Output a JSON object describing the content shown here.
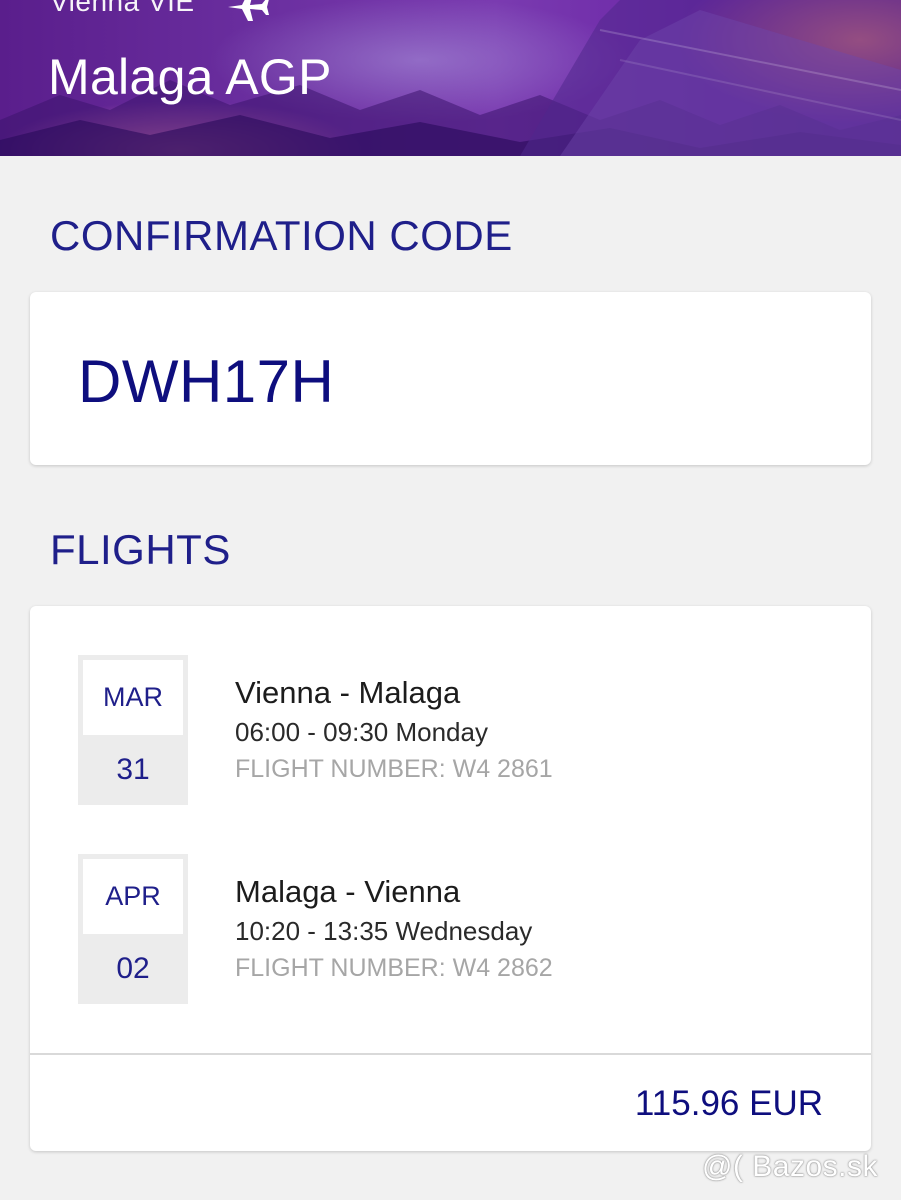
{
  "header": {
    "from": "Vienna VIE",
    "to": "Malaga AGP",
    "plane_icon": "plane-icon"
  },
  "confirmation": {
    "title": "CONFIRMATION CODE",
    "code": "DWH17H"
  },
  "flights_section": {
    "title": "FLIGHTS",
    "flights": [
      {
        "month": "MAR",
        "day": "31",
        "route": "Vienna - Malaga",
        "time": "06:00 - 09:30 Monday",
        "flight_number": "FLIGHT NUMBER: W4 2861"
      },
      {
        "month": "APR",
        "day": "02",
        "route": "Malaga - Vienna",
        "time": "10:20 - 13:35 Wednesday",
        "flight_number": "FLIGHT NUMBER: W4 2862"
      }
    ],
    "total_price": "115.96 EUR"
  },
  "watermark": "@( Bazos.sk",
  "colors": {
    "accent": "#1f1f8a",
    "code": "#0e0e7e",
    "header_purple": "#6b2fa0",
    "background": "#f1f1f1",
    "muted": "#a6a6a6"
  }
}
